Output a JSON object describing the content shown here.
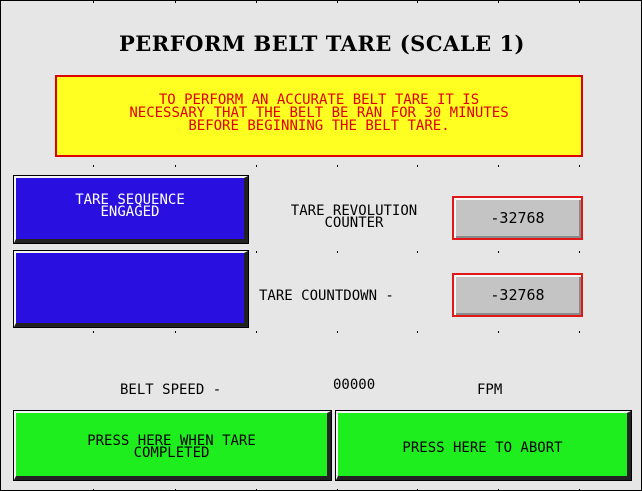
{
  "title": "PERFORM BELT TARE (SCALE 1)",
  "warning": {
    "lines": [
      "TO PERFORM AN ACCURATE BELT TARE IT IS",
      "NECESSARY THAT THE BELT BE RAN FOR 30 MINUTES",
      "BEFORE BEGINNING THE BELT TARE."
    ]
  },
  "tare_sequence_button": {
    "lines": [
      "TARE SEQUENCE",
      "ENGAGED"
    ]
  },
  "revolution_counter": {
    "label_lines": [
      "TARE REVOLUTION",
      "COUNTER"
    ],
    "value": "-32768"
  },
  "countdown": {
    "label": "TARE COUNTDOWN -",
    "value": "-32768"
  },
  "belt_speed": {
    "label": "BELT SPEED -",
    "value": "00000",
    "unit": "FPM"
  },
  "complete_button": {
    "lines": [
      "PRESS HERE WHEN TARE",
      "COMPLETED"
    ]
  },
  "abort_button": {
    "label": "PRESS HERE TO ABORT"
  },
  "colors": {
    "background": "#e6e6e6",
    "warning_fill": "#ffff22",
    "warning_text": "#e00000",
    "blue_button": "#2a10e0",
    "green_button": "#1eee1e",
    "value_box": "#c4c4c4",
    "value_border": "#e01818"
  }
}
